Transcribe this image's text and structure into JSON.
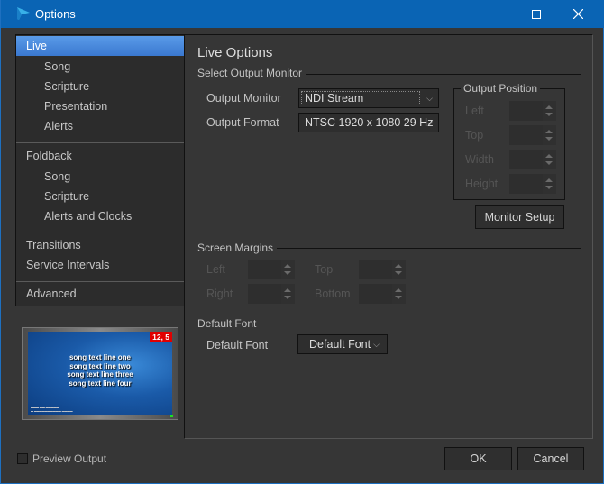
{
  "window": {
    "title": "Options",
    "controls": {
      "minimize": "minimize",
      "maximize": "maximize",
      "close": "close"
    }
  },
  "sidebar": {
    "items": [
      {
        "label": "Live",
        "level": "top",
        "active": true
      },
      {
        "label": "Song",
        "level": "sub"
      },
      {
        "label": "Scripture",
        "level": "sub"
      },
      {
        "label": "Presentation",
        "level": "sub"
      },
      {
        "label": "Alerts",
        "level": "sub"
      },
      {
        "label": "Foldback",
        "level": "top"
      },
      {
        "label": "Song",
        "level": "sub"
      },
      {
        "label": "Scripture",
        "level": "sub"
      },
      {
        "label": "Alerts and Clocks",
        "level": "sub"
      },
      {
        "label": "Transitions",
        "level": "top"
      },
      {
        "label": "Service Intervals",
        "level": "top"
      },
      {
        "label": "Advanced",
        "level": "top"
      }
    ]
  },
  "preview": {
    "badge": "12, 5",
    "lines": [
      "song text line one",
      "song text line two",
      "song text line three",
      "song text line four"
    ],
    "checkbox_label": "Preview Output",
    "checked": false
  },
  "main": {
    "title": "Live Options",
    "output_monitor_group": {
      "title": "Select Output Monitor",
      "output_monitor_label": "Output Monitor",
      "output_monitor_value": "NDI Stream",
      "output_format_label": "Output Format",
      "output_format_value": "NTSC 1920 x 1080 29 Hz"
    },
    "output_position": {
      "title": "Output Position",
      "left_label": "Left",
      "top_label": "Top",
      "width_label": "Width",
      "height_label": "Height",
      "monitor_setup_label": "Monitor Setup"
    },
    "screen_margins": {
      "title": "Screen Margins",
      "left_label": "Left",
      "top_label": "Top",
      "right_label": "Right",
      "bottom_label": "Bottom"
    },
    "default_font": {
      "title": "Default Font",
      "label": "Default Font",
      "value": "Default Font"
    }
  },
  "footer": {
    "ok_label": "OK",
    "cancel_label": "Cancel"
  },
  "colors": {
    "titlebar": "#0a64b4",
    "accent": "#3a78d0",
    "background": "#363636",
    "badge": "#e00000"
  }
}
